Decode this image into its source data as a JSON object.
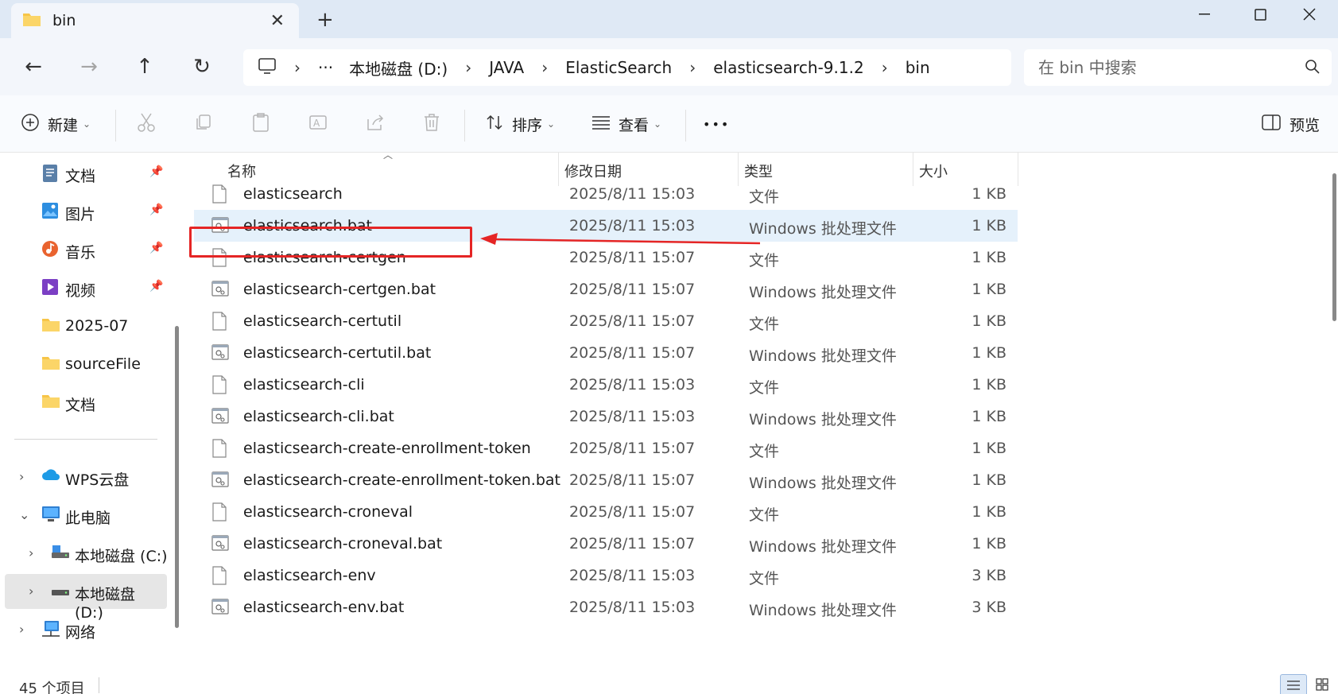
{
  "tab": {
    "title": "bin"
  },
  "address": {
    "segments": [
      "本地磁盘 (D:)",
      "JAVA",
      "ElasticSearch",
      "elasticsearch-9.1.2",
      "bin"
    ],
    "ellipsis": "···"
  },
  "search": {
    "placeholder": "在 bin 中搜索"
  },
  "toolbar": {
    "new_label": "新建",
    "sort_label": "排序",
    "view_label": "查看",
    "more_label": "•••",
    "preview_label": "预览"
  },
  "sidebar": {
    "quick": [
      {
        "label": "文档",
        "icon": "documents-icon"
      },
      {
        "label": "图片",
        "icon": "pictures-icon"
      },
      {
        "label": "音乐",
        "icon": "music-icon"
      },
      {
        "label": "视频",
        "icon": "videos-icon"
      }
    ],
    "folders": [
      "2025-07",
      "sourceFile",
      "文档"
    ],
    "tree": [
      "WPS云盘",
      "此电脑",
      "本地磁盘 (C:)",
      "本地磁盘 (D:)",
      "网络"
    ]
  },
  "columns": {
    "name": "名称",
    "date": "修改日期",
    "type": "类型",
    "size": "大小"
  },
  "files": [
    {
      "name": "elasticsearch",
      "date": "2025/8/11 15:03",
      "type": "文件",
      "size": "1 KB"
    },
    {
      "name": "elasticsearch.bat",
      "date": "2025/8/11 15:03",
      "type": "Windows 批处理文件",
      "size": "1 KB"
    },
    {
      "name": "elasticsearch-certgen",
      "date": "2025/8/11 15:07",
      "type": "文件",
      "size": "1 KB"
    },
    {
      "name": "elasticsearch-certgen.bat",
      "date": "2025/8/11 15:07",
      "type": "Windows 批处理文件",
      "size": "1 KB"
    },
    {
      "name": "elasticsearch-certutil",
      "date": "2025/8/11 15:07",
      "type": "文件",
      "size": "1 KB"
    },
    {
      "name": "elasticsearch-certutil.bat",
      "date": "2025/8/11 15:07",
      "type": "Windows 批处理文件",
      "size": "1 KB"
    },
    {
      "name": "elasticsearch-cli",
      "date": "2025/8/11 15:03",
      "type": "文件",
      "size": "1 KB"
    },
    {
      "name": "elasticsearch-cli.bat",
      "date": "2025/8/11 15:03",
      "type": "Windows 批处理文件",
      "size": "1 KB"
    },
    {
      "name": "elasticsearch-create-enrollment-token",
      "date": "2025/8/11 15:07",
      "type": "文件",
      "size": "1 KB"
    },
    {
      "name": "elasticsearch-create-enrollment-token.bat",
      "date": "2025/8/11 15:07",
      "type": "Windows 批处理文件",
      "size": "1 KB"
    },
    {
      "name": "elasticsearch-croneval",
      "date": "2025/8/11 15:07",
      "type": "文件",
      "size": "1 KB"
    },
    {
      "name": "elasticsearch-croneval.bat",
      "date": "2025/8/11 15:07",
      "type": "Windows 批处理文件",
      "size": "1 KB"
    },
    {
      "name": "elasticsearch-env",
      "date": "2025/8/11 15:03",
      "type": "文件",
      "size": "3 KB"
    },
    {
      "name": "elasticsearch-env.bat",
      "date": "2025/8/11 15:03",
      "type": "Windows 批处理文件",
      "size": "3 KB"
    }
  ],
  "status": {
    "item_count": "45 个项目"
  },
  "colors": {
    "accent": "#0067c0",
    "selection": "#e5f1fb",
    "annotation": "#e52525",
    "folder": "#f7c548"
  }
}
